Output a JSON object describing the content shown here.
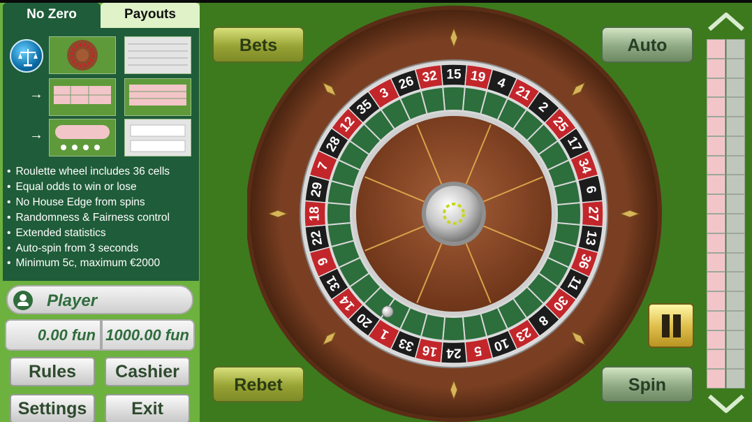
{
  "tabs": {
    "active": "No Zero",
    "other": "Payouts"
  },
  "features": [
    "Roulette wheel includes 36 cells",
    "Equal odds to win or lose",
    "No House Edge from spins",
    "Randomness & Fairness control",
    "Extended statistics",
    "Auto-spin from 3 seconds",
    "Minimum 5c, maximum €2000"
  ],
  "player": {
    "name": "Player",
    "bet": "0.00 fun",
    "balance": "1000.00 fun"
  },
  "buttons": {
    "rules": "Rules",
    "cashier": "Cashier",
    "settings": "Settings",
    "exit": "Exit",
    "bets": "Bets",
    "auto": "Auto",
    "rebet": "Rebet",
    "spin": "Spin"
  },
  "wheel": {
    "numbers": [
      15,
      19,
      4,
      21,
      2,
      25,
      17,
      34,
      6,
      27,
      13,
      36,
      11,
      30,
      8,
      23,
      10,
      5,
      24,
      16,
      33,
      1,
      20,
      14,
      31,
      9,
      22,
      18,
      29,
      7,
      28,
      12,
      35,
      3,
      26,
      32
    ],
    "red": [
      19,
      21,
      25,
      34,
      27,
      36,
      30,
      23,
      5,
      16,
      1,
      14,
      9,
      18,
      7,
      12,
      3,
      32
    ],
    "colors": {
      "red": "#c2262b",
      "black": "#1c1c1c",
      "pocket": "#2c6e3c",
      "wood": "#8b4a2a"
    }
  },
  "stats": {
    "rows": 18,
    "pink": "#f2c5c9",
    "gray": "#bfc7bd"
  },
  "icons": [
    "scales-icon",
    "arrow-right-icon",
    "user-icon",
    "pause-icon",
    "chevron-up-icon",
    "chevron-down-icon",
    "diamond-marker-icon"
  ]
}
